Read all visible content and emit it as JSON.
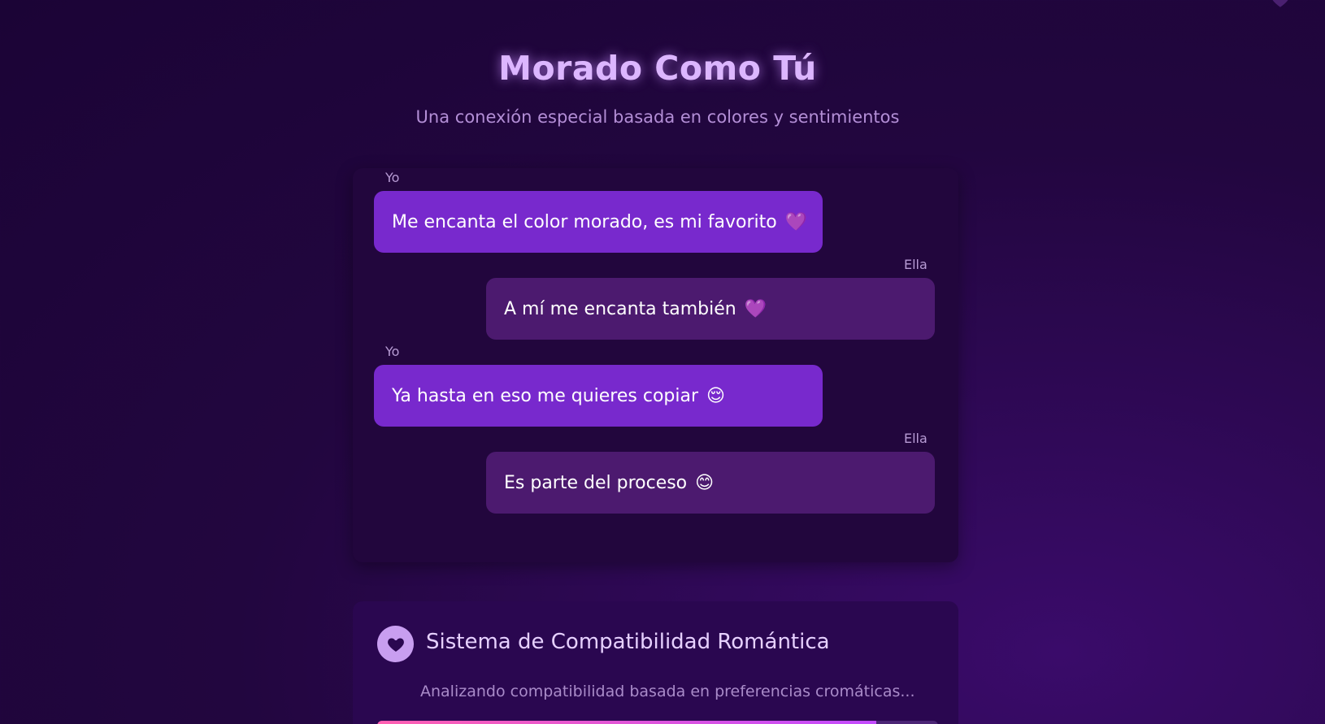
{
  "header": {
    "title": "Morado Como Tú",
    "subtitle": "Una conexión especial basada en colores y sentimientos"
  },
  "chat": {
    "messages": [
      {
        "sender": "Yo",
        "text": "Me encanta el color morado, es mi favorito",
        "emoji": "💜",
        "side": "left"
      },
      {
        "sender": "Ella",
        "text": "A mí me encanta también",
        "emoji": "💜",
        "side": "right"
      },
      {
        "sender": "Yo",
        "text": "Ya hasta en eso me quieres copiar",
        "emoji": "😌",
        "side": "left"
      },
      {
        "sender": "Ella",
        "text": "Es parte del proceso",
        "emoji": "😊",
        "side": "right"
      }
    ]
  },
  "compatibility": {
    "icon": "heart-icon",
    "title": "Sistema de Compatibilidad Romántica",
    "description": "Analizando compatibilidad basada en preferencias cromáticas..."
  },
  "colors": {
    "my_bubble": "#7829cd",
    "her_bubble": "#4c1a6f",
    "title": "#dcb6ff",
    "background": "#22063f"
  }
}
